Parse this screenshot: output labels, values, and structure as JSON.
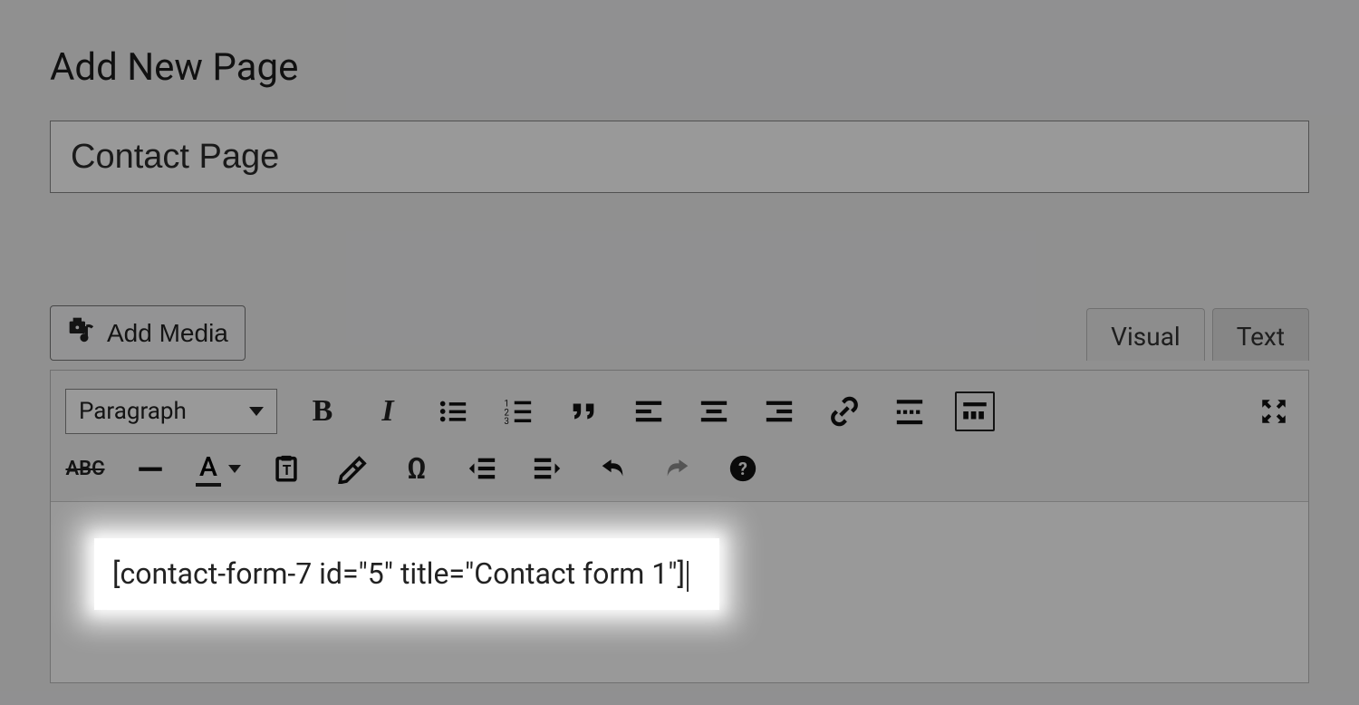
{
  "header": {
    "title": "Add New Page"
  },
  "title_field": {
    "value": "Contact Page"
  },
  "media_button": {
    "label": "Add Media"
  },
  "tabs": {
    "visual": "Visual",
    "text": "Text",
    "active": "visual"
  },
  "toolbar": {
    "format_select": "Paragraph",
    "row1": [
      "bold",
      "italic",
      "bullet-list",
      "numbered-list",
      "blockquote",
      "align-left",
      "align-center",
      "align-right",
      "link",
      "read-more",
      "toolbar-toggle"
    ],
    "row1_right": [
      "fullscreen"
    ],
    "row2": [
      "strikethrough",
      "horizontal-rule",
      "text-color",
      "paste-text",
      "clear-formatting",
      "special-character",
      "outdent",
      "indent",
      "undo",
      "redo",
      "help"
    ]
  },
  "editor": {
    "content": "[contact-form-7 id=\"5\" title=\"Contact form 1\"]"
  }
}
